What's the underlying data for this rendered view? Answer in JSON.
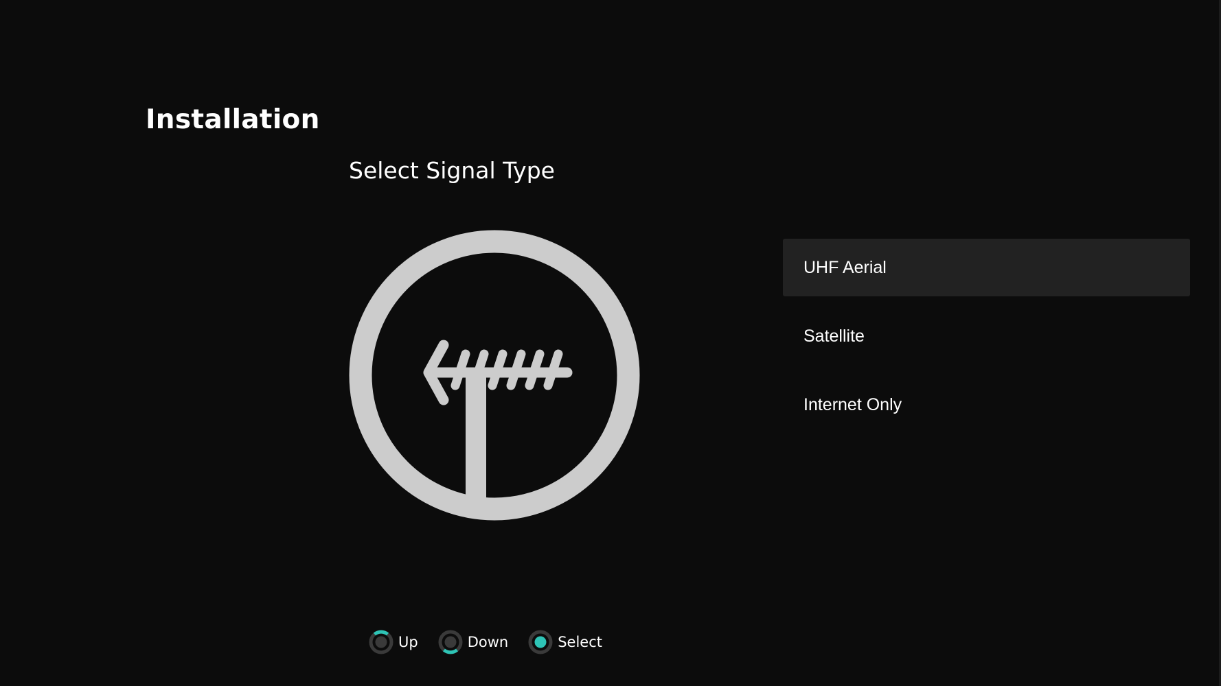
{
  "header": {
    "title": "Installation"
  },
  "main": {
    "subtitle": "Select Signal Type",
    "illustration_icon": "aerial-antenna-icon"
  },
  "options": [
    {
      "label": "UHF Aerial",
      "selected": true
    },
    {
      "label": "Satellite",
      "selected": false
    },
    {
      "label": "Internet Only",
      "selected": false
    }
  ],
  "hints": [
    {
      "label": "Up",
      "icon": "dpad-up-icon"
    },
    {
      "label": "Down",
      "icon": "dpad-down-icon"
    },
    {
      "label": "Select",
      "icon": "dpad-select-icon"
    }
  ],
  "colors": {
    "background": "#0c0c0c",
    "selected_option": "#222222",
    "illustration": "#cccccc",
    "accent": "#2ec4b6",
    "hint_ring": "#3a3a3a"
  }
}
